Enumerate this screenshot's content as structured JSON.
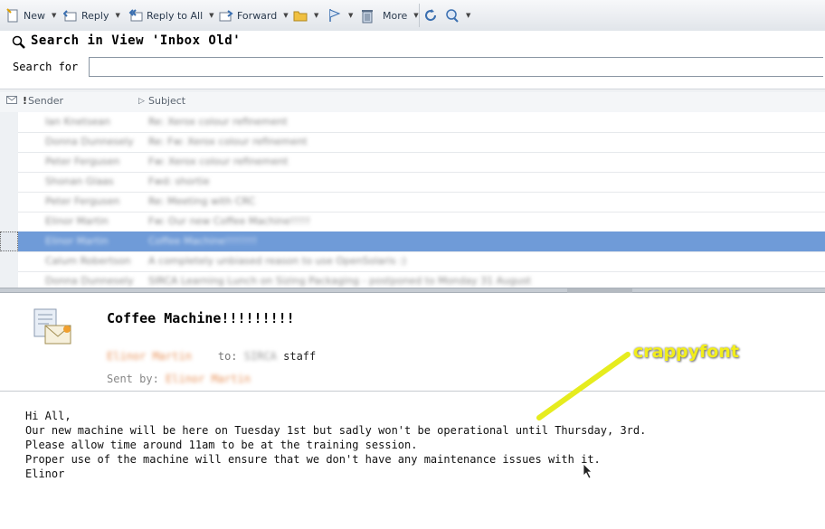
{
  "toolbar": {
    "new_label": "New",
    "reply_label": "Reply",
    "reply_all_label": "Reply to All",
    "forward_label": "Forward",
    "more_label": "More"
  },
  "search": {
    "title": "Search in View 'Inbox Old'",
    "label": "Search for",
    "value": ""
  },
  "list": {
    "columns": {
      "sender": "Sender",
      "subject": "Subject"
    },
    "rows": [
      {
        "sender": "Ian Knetsean",
        "subject": "Re: Xerox colour refinement"
      },
      {
        "sender": "Donna Dunnesely",
        "subject": "Re: Fw: Xerox colour refinement"
      },
      {
        "sender": "Peter Fergusen",
        "subject": "Fw: Xerox colour refinement"
      },
      {
        "sender": "Shonan Glaas",
        "subject": "Fwd: shortie"
      },
      {
        "sender": "Peter Fergusen",
        "subject": "Re: Meeting with CRC"
      },
      {
        "sender": "Elinor Martin",
        "subject": "Fw: Our new Coffee Machine!!!!!"
      },
      {
        "sender": "Elinor Martin",
        "subject": "Coffee Machine!!!!!!!!"
      },
      {
        "sender": "Calum Robertson",
        "subject": "A completely unbiased reason to use OpenSolaris :)"
      },
      {
        "sender": "Donna Dunnesely",
        "subject": "SIRCA Learning Lunch on Sizing Packaging - postponed to Monday 31 August"
      }
    ]
  },
  "message": {
    "subject": "Coffee Machine!!!!!!!!!",
    "from": "Elinor Martin",
    "to_label": "to:",
    "to_dept": "SIRCA",
    "to_group": "staff",
    "sent_by_label": "Sent by:",
    "sent_by": "Elinor Martin",
    "body": "Hi All,\nOur new machine will be here on Tuesday 1st but sadly won't be operational until Thursday, 3rd.\nPlease allow time around 11am to be at the training session.\nProper use of the machine will ensure that we don't have any maintenance issues with it.\nElinor"
  },
  "annotation": {
    "text": "crappyfont",
    "color": "#f2ee1a"
  },
  "colors": {
    "selection": "#6f9bd8",
    "toolbar_text": "#2a3a4d",
    "sender_orange": "#e8925a"
  }
}
